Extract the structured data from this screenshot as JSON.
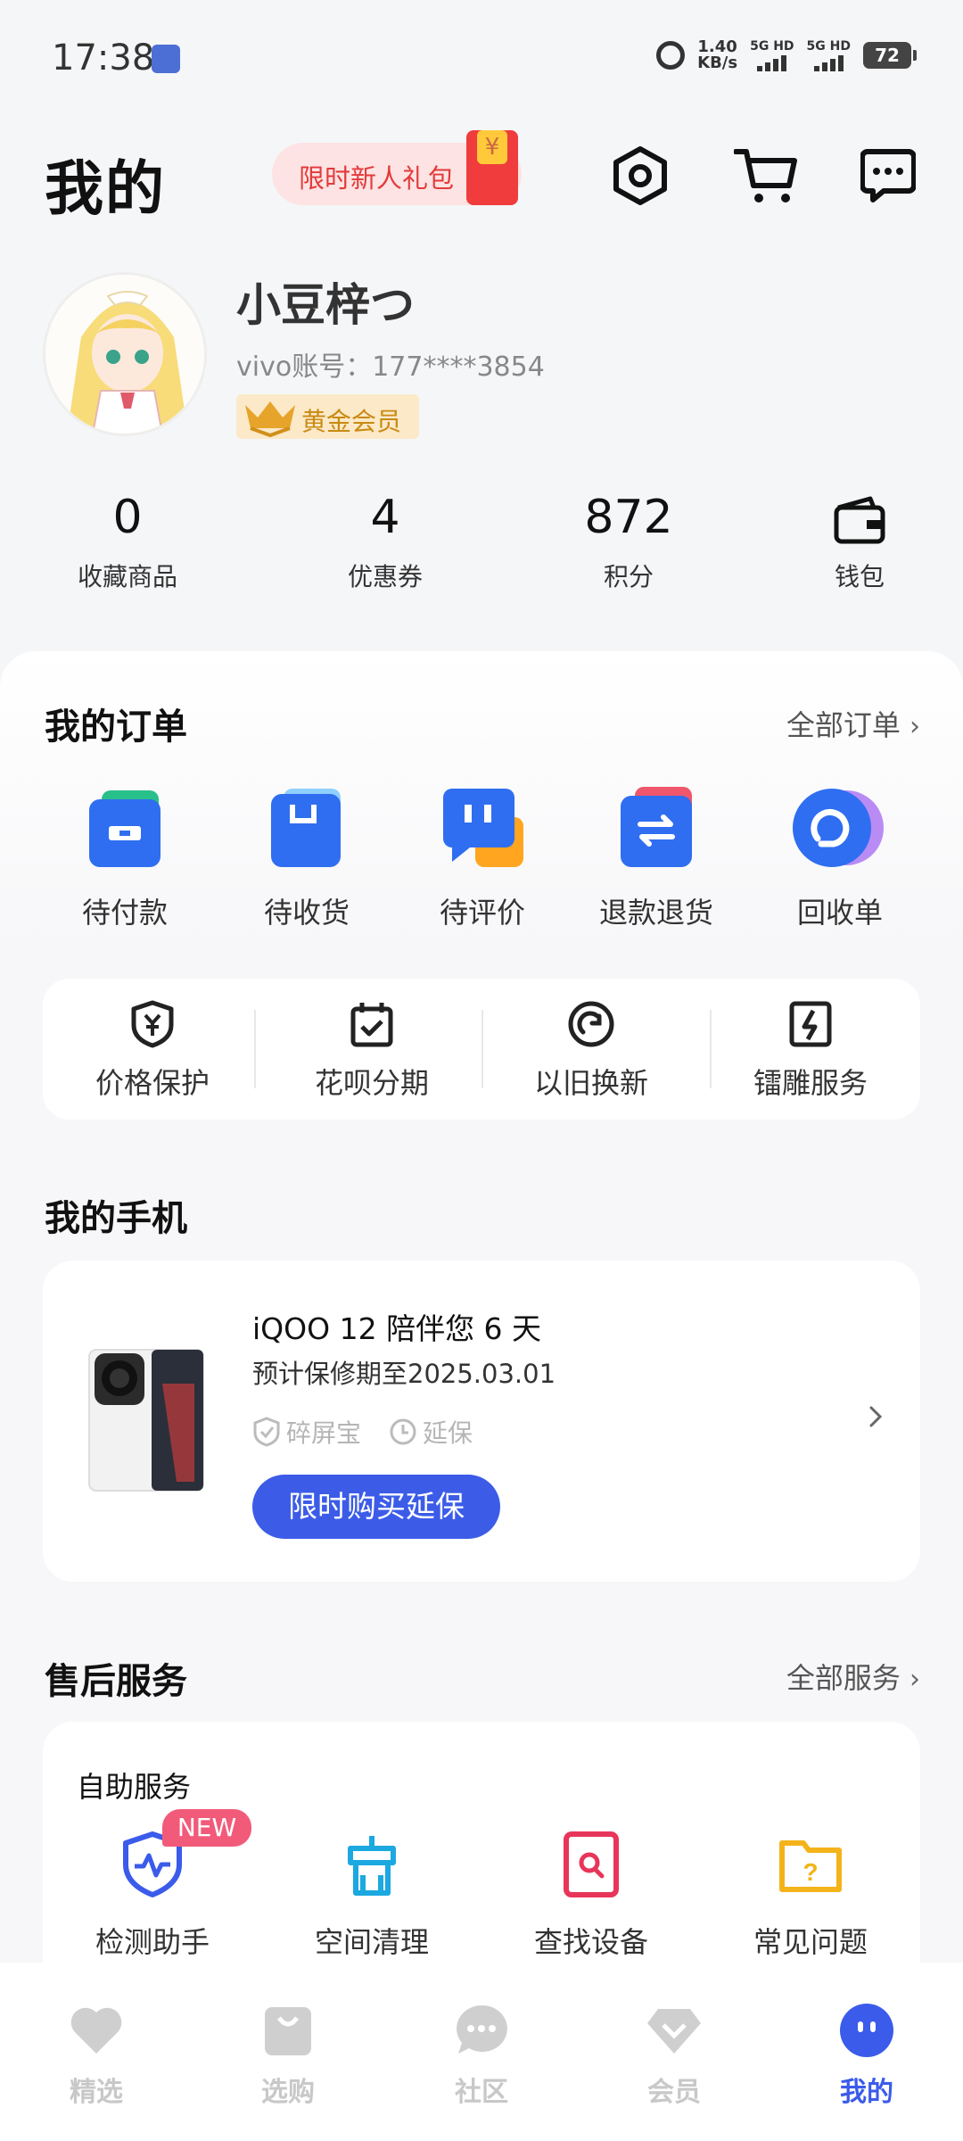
{
  "status_bar": {
    "time": "17:38",
    "net_speed": "1.40",
    "net_unit": "KB/s",
    "sim1": "5G HD",
    "sim2": "5G HD",
    "battery": "72"
  },
  "header": {
    "title": "我的",
    "promo_label": "限时新人礼包"
  },
  "profile": {
    "nickname": "小豆梓つ",
    "account": "vivo账号：177****3854",
    "member_level": "黄金会员"
  },
  "stats": [
    {
      "value": "0",
      "label": "收藏商品"
    },
    {
      "value": "4",
      "label": "优惠券"
    },
    {
      "value": "872",
      "label": "积分"
    },
    {
      "label": "钱包"
    }
  ],
  "orders": {
    "title": "我的订单",
    "all_link": "全部订单",
    "items": [
      {
        "label": "待付款"
      },
      {
        "label": "待收货"
      },
      {
        "label": "待评价"
      },
      {
        "label": "退款退货"
      },
      {
        "label": "回收单"
      }
    ],
    "services": [
      {
        "label": "价格保护"
      },
      {
        "label": "花呗分期"
      },
      {
        "label": "以旧换新"
      },
      {
        "label": "镭雕服务"
      }
    ]
  },
  "phone": {
    "section_title": "我的手机",
    "title": "iQOO 12 陪伴您 6 天",
    "warranty": "预计保修期至2025.03.01",
    "tag1": "碎屏宝",
    "tag2": "延保",
    "button": "限时购买延保"
  },
  "after_sales": {
    "title": "售后服务",
    "all_link": "全部服务",
    "subtitle": "自助服务",
    "new_badge": "NEW",
    "tools": [
      {
        "label": "检测助手"
      },
      {
        "label": "空间清理"
      },
      {
        "label": "查找设备"
      },
      {
        "label": "常见问题"
      }
    ]
  },
  "tabs": [
    {
      "label": "精选"
    },
    {
      "label": "选购"
    },
    {
      "label": "社区"
    },
    {
      "label": "会员"
    },
    {
      "label": "我的"
    }
  ],
  "colors": {
    "accent": "#3b5bea",
    "promo_red": "#e33a3a",
    "gold": "#c98a12",
    "order_blue": "#2f6ef0"
  }
}
